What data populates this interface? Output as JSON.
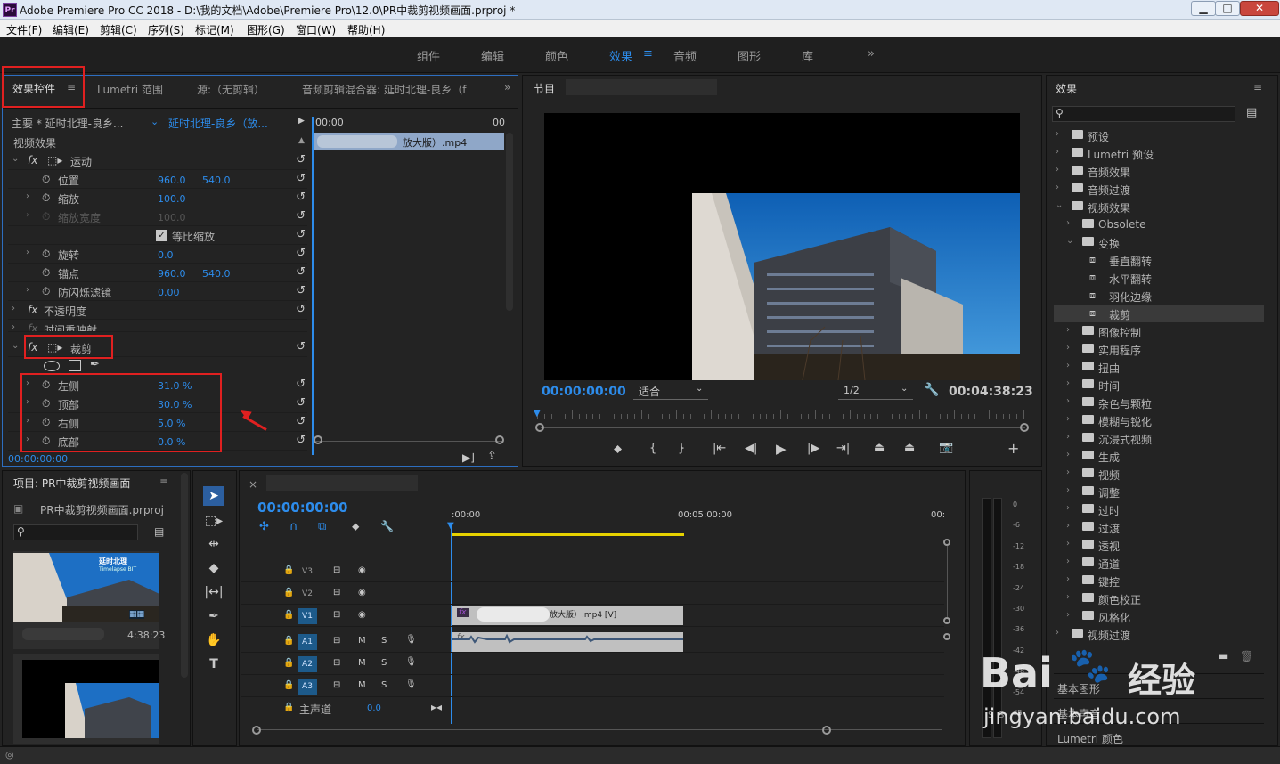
{
  "titlebar": {
    "title": "Adobe Premiere Pro CC 2018 - D:\\我的文档\\Adobe\\Premiere Pro\\12.0\\PR中裁剪视频画面.prproj *",
    "logo": "Pr",
    "min": "▁",
    "max": "□",
    "close": "✕"
  },
  "menu": [
    "文件(F)",
    "编辑(E)",
    "剪辑(C)",
    "序列(S)",
    "标记(M)",
    "图形(G)",
    "窗口(W)",
    "帮助(H)"
  ],
  "workspaces": [
    "组件",
    "编辑",
    "颜色",
    "效果",
    "音频",
    "图形",
    "库"
  ],
  "workspace_more": "»",
  "workspace_menu": "≡",
  "effect_controls": {
    "tabs": [
      "效果控件",
      "Lumetri 范围",
      "源:（无剪辑）",
      "音频剪辑混合器: 延时北理-良乡（f"
    ],
    "tab_menu": "≡",
    "tab_more": "»",
    "master": "主要 * 延时北理-良乡...",
    "clip": "延时北理-良乡（放...",
    "tc_start": "00:00",
    "tc_end": "00",
    "clip_bar": "放大版）.mp4",
    "section": "视频效果",
    "rows": [
      {
        "name": "运动",
        "type": "fx"
      },
      {
        "name": "位置",
        "v1": "960.0",
        "v2": "540.0"
      },
      {
        "name": "缩放",
        "v1": "100.0"
      },
      {
        "name": "缩放宽度",
        "v1": "100.0",
        "dim": true
      },
      {
        "name": "等比缩放",
        "check": true
      },
      {
        "name": "旋转",
        "v1": "0.0"
      },
      {
        "name": "锚点",
        "v1": "960.0",
        "v2": "540.0"
      },
      {
        "name": "防闪烁滤镜",
        "v1": "0.00"
      },
      {
        "name": "不透明度",
        "type": "fx"
      },
      {
        "name": "时间重映射",
        "type": "fx"
      },
      {
        "name": "裁剪",
        "type": "fx"
      },
      {
        "name": "左侧",
        "v1": "31.0 %"
      },
      {
        "name": "顶部",
        "v1": "30.0 %"
      },
      {
        "name": "右侧",
        "v1": "5.0 %"
      },
      {
        "name": "底部",
        "v1": "0.0 %"
      }
    ],
    "timecode": "00:00:00:00"
  },
  "program": {
    "label": "节目",
    "timecode": "00:00:00:00",
    "fit": "适合",
    "resolution": "1/2",
    "duration": "00:04:38:23"
  },
  "effects_panel": {
    "title": "效果",
    "menu": "≡",
    "items": [
      {
        "label": "预设",
        "level": 0
      },
      {
        "label": "Lumetri 预设",
        "level": 0
      },
      {
        "label": "音频效果",
        "level": 0
      },
      {
        "label": "音频过渡",
        "level": 0
      },
      {
        "label": "视频效果",
        "level": 0,
        "open": true
      },
      {
        "label": "Obsolete",
        "level": 1
      },
      {
        "label": "变换",
        "level": 1,
        "open": true
      },
      {
        "label": "垂直翻转",
        "level": 2
      },
      {
        "label": "水平翻转",
        "level": 2
      },
      {
        "label": "羽化边缘",
        "level": 2
      },
      {
        "label": "裁剪",
        "level": 2,
        "selected": true
      },
      {
        "label": "图像控制",
        "level": 1
      },
      {
        "label": "实用程序",
        "level": 1
      },
      {
        "label": "扭曲",
        "level": 1
      },
      {
        "label": "时间",
        "level": 1
      },
      {
        "label": "杂色与颗粒",
        "level": 1
      },
      {
        "label": "模糊与锐化",
        "level": 1
      },
      {
        "label": "沉浸式视频",
        "level": 1
      },
      {
        "label": "生成",
        "level": 1
      },
      {
        "label": "视频",
        "level": 1
      },
      {
        "label": "调整",
        "level": 1
      },
      {
        "label": "过时",
        "level": 1
      },
      {
        "label": "过渡",
        "level": 1
      },
      {
        "label": "透视",
        "level": 1
      },
      {
        "label": "通道",
        "level": 1
      },
      {
        "label": "键控",
        "level": 1
      },
      {
        "label": "颜色校正",
        "level": 1
      },
      {
        "label": "风格化",
        "level": 1
      },
      {
        "label": "视频过渡",
        "level": 0
      }
    ],
    "extra": [
      "基本图形",
      "基本声音",
      "Lumetri 颜色"
    ]
  },
  "project": {
    "title": "项目: PR中裁剪视频画面",
    "menu": "≡",
    "file": "PR中裁剪视频画面.prproj",
    "thumb_duration": "4:38:23",
    "thumb_text": "延时北理",
    "thumb_subtext": "Timelapse BIT"
  },
  "timeline": {
    "close": "×",
    "timecode": "00:00:00:00",
    "ruler": [
      ":00:00",
      "00:05:00:00",
      "00:"
    ],
    "tracks": [
      {
        "name": "V3",
        "kind": "video"
      },
      {
        "name": "V2",
        "kind": "video"
      },
      {
        "name": "V1",
        "kind": "video",
        "clip": "放大版）.mp4 [V]"
      },
      {
        "name": "A1",
        "kind": "audio"
      },
      {
        "name": "A2",
        "kind": "audio"
      },
      {
        "name": "A3",
        "kind": "audio"
      }
    ],
    "master": "主声道",
    "master_val": "0.0"
  },
  "meter": {
    "ticks": [
      "0",
      "-6",
      "-12",
      "-18",
      "-24",
      "-30",
      "-36",
      "-42",
      "-48",
      "-54",
      "dB"
    ],
    "ss": "S S"
  },
  "watermark": {
    "brand": "Bai",
    "brand2": "经验",
    "url": "jingyan.baidu.com"
  }
}
